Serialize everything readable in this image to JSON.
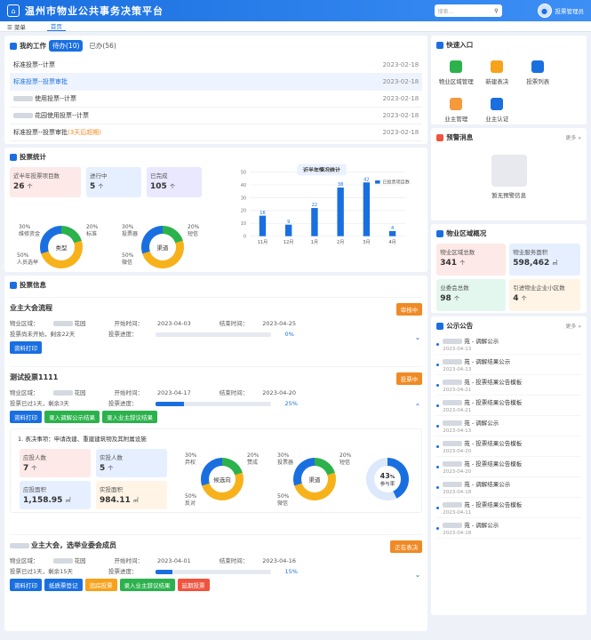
{
  "header": {
    "title": "温州市物业公共事务决策平台",
    "search_placeholder": "搜索...",
    "user": "投票管理员"
  },
  "nav": {
    "menu": "菜单",
    "home": "首页"
  },
  "work": {
    "title": "我的工作",
    "tab_pending": "待办(10)",
    "tab_done": "已办(56)",
    "rows": [
      {
        "title": "标准投票--计票",
        "date": "2023-02-18"
      },
      {
        "title": "标准投票--投票审批",
        "date": "2023-02-18"
      },
      {
        "title": "使用投票--计票",
        "date": "2023-02-18"
      },
      {
        "title": "花园使用投票--计票",
        "date": "2023-02-18"
      },
      {
        "title": "标准投票--投票审批",
        "extra": "(3天后超期)",
        "date": "2023-02-18"
      }
    ]
  },
  "stats": {
    "title": "投票统计",
    "boxes": [
      {
        "label": "近半年投票项目数",
        "value": "26",
        "unit": "个"
      },
      {
        "label": "进行中",
        "value": "5",
        "unit": "个"
      },
      {
        "label": "已完成",
        "value": "105",
        "unit": "个"
      }
    ],
    "donut1": {
      "center": "类型",
      "l1": "30%",
      "l1b": "维修资金",
      "l2": "20%",
      "l2b": "标准",
      "l3": "50%",
      "l3b": "人员选举"
    },
    "donut2": {
      "center": "渠道",
      "l1": "30%",
      "l1b": "投票器",
      "l2": "20%",
      "l2b": "短信",
      "l3": "50%",
      "l3b": "微信"
    }
  },
  "chart_data": {
    "type": "bar",
    "title": "近半年情况统计",
    "legend": "已投票项目数",
    "categories": [
      "11月",
      "12月",
      "1月",
      "2月",
      "3月",
      "4月"
    ],
    "values": [
      16,
      9,
      22,
      38,
      42,
      4
    ],
    "ylim": [
      0,
      50
    ],
    "yticks": [
      "0",
      "10",
      "20",
      "30",
      "40",
      "50"
    ]
  },
  "votes": {
    "title": "投票信息",
    "items": [
      {
        "name": "业主大会流程",
        "area_label": "物业区域：",
        "area": "花园",
        "start_label": "开始时间：",
        "start": "2023-04-03",
        "end_label": "结束时间：",
        "end": "2023-04-25",
        "status": "投票尚未开始，剩余22天",
        "prog_label": "投票进度：",
        "progress": "0%",
        "tag": "审核中",
        "buttons": [
          "资料打印"
        ]
      },
      {
        "name": "测试投票1111",
        "area_label": "物业区域：",
        "area": "花园",
        "start_label": "开始时间：",
        "start": "2023-04-17",
        "end_label": "结束时间：",
        "end": "2023-04-20",
        "status": "投票已过1天，剩余3天",
        "prog_label": "投票进度：",
        "progress": "25%",
        "tag": "投票中",
        "buttons": [
          "资料打印",
          "录入调解公示结果",
          "录入业主辞议结果"
        ]
      },
      {
        "name": "业主大会，选举业委会成员",
        "area_label": "物业区域：",
        "area": "花园",
        "start_label": "开始时间：",
        "start": "2023-04-01",
        "end_label": "结束时间：",
        "end": "2023-04-16",
        "status": "投票已过1天，剩余15天",
        "prog_label": "投票进度：",
        "progress": "15%",
        "tag": "正在表决",
        "buttons": [
          "资料打印",
          "纸质票登记",
          "追踪投票",
          "录入业主辞议结果",
          "延期投票"
        ]
      }
    ],
    "detail": {
      "q": "1. 表决事项：申请改建、重建建筑物及其附属设施",
      "boxes": [
        {
          "l": "应投人数",
          "v": "7",
          "u": "个"
        },
        {
          "l": "实投人数",
          "v": "5",
          "u": "个"
        },
        {
          "l": "应投面积",
          "v": "1,158.95",
          "u": "㎡"
        },
        {
          "l": "实投面积",
          "v": "984.11",
          "u": "㎡"
        }
      ],
      "d1": {
        "c": "候选向",
        "a": "30%",
        "ab": "弃权",
        "b": "20%",
        "bb": "赞成",
        "c2": "50%",
        "cb": "反对"
      },
      "d2": {
        "c": "渠道",
        "a": "30%",
        "ab": "投票器",
        "b": "20%",
        "bb": "短信",
        "c2": "50%",
        "cb": "微信"
      },
      "rate": "43",
      "rate_unit": "%",
      "rate_label": "参与率"
    }
  },
  "quick": {
    "title": "快速入口",
    "items": [
      "物业区域管理",
      "新建表决",
      "投票列表",
      "业主管理",
      "业主认证"
    ]
  },
  "alert": {
    "title": "预警消息",
    "more": "更多 »",
    "empty": "暂无预警信息"
  },
  "region": {
    "title": "物业区域概况",
    "boxes": [
      {
        "l": "物业区域总数",
        "v": "341",
        "u": "个"
      },
      {
        "l": "物业服务面积",
        "v": "598,462",
        "u": "㎡"
      },
      {
        "l": "业委会总数",
        "v": "98",
        "u": "个"
      },
      {
        "l": "引进物业企业小区数",
        "v": "4",
        "u": "个"
      }
    ]
  },
  "announce": {
    "title": "公示公告",
    "more": "更多 »",
    "items": [
      {
        "t": "苑 - 调解公示",
        "s": "2023-04-13"
      },
      {
        "t": "苑 - 调解结果公示",
        "s": "2023-04-13"
      },
      {
        "t": "苑 - 投票结果公告模板",
        "s": "2023-04-21"
      },
      {
        "t": "苑 - 投票结果公告模板",
        "s": "2023-04-21"
      },
      {
        "t": "苑 - 调解公示",
        "s": "2023-04-13"
      },
      {
        "t": "苑 - 投票结果公告模板",
        "s": "2023-04-20"
      },
      {
        "t": "苑 - 投票结果公告模板",
        "s": "2023-04-20"
      },
      {
        "t": "苑 - 调解结果公示",
        "s": "2023-04-18"
      },
      {
        "t": "苑 - 投票结果公告模板",
        "s": "2023-04-11"
      },
      {
        "t": "苑 - 调解公示",
        "s": "2023-04-18"
      }
    ]
  }
}
